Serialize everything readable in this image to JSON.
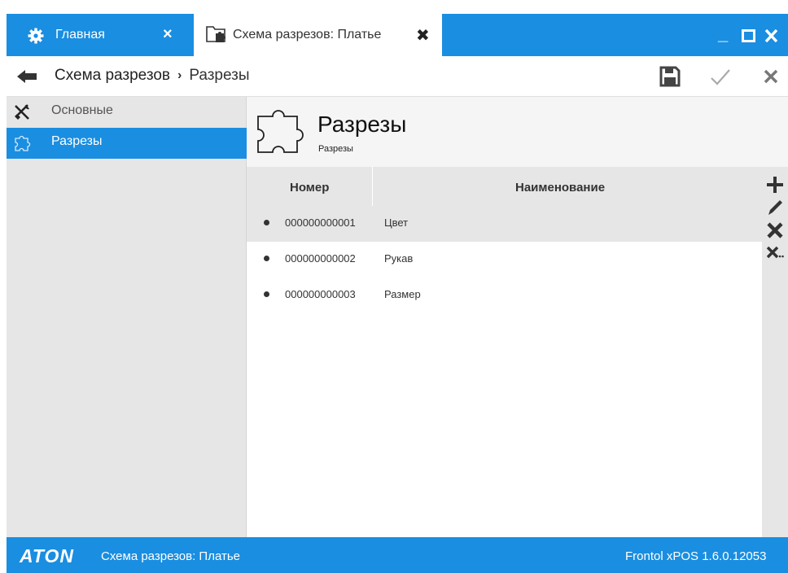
{
  "colors": {
    "accent": "#1a8ee1",
    "panel": "#e6e6e6",
    "header_bg": "#f5f5f5"
  },
  "tabs": [
    {
      "label": "Главная",
      "icon": "gear-icon",
      "close": "×"
    },
    {
      "label": "Схема разрезов: Платье",
      "icon": "folder-puzzle-icon",
      "close": "✖"
    }
  ],
  "window": {
    "minimize": "_",
    "maximize": "□",
    "close": "×"
  },
  "toolbar": {
    "breadcrumb": [
      "Схема разрезов",
      "Разрезы"
    ],
    "separator": "›",
    "actions": [
      "save-icon",
      "check-icon",
      "close-icon"
    ]
  },
  "sidebar": {
    "items": [
      {
        "label": "Основные",
        "icon": "tools-icon",
        "active": false
      },
      {
        "label": "Разрезы",
        "icon": "puzzle-icon",
        "active": true
      }
    ]
  },
  "page": {
    "title": "Разрезы",
    "subtitle": "Разрезы"
  },
  "grid": {
    "columns": [
      "Номер",
      "Наименование"
    ],
    "rows": [
      {
        "number": "000000000001",
        "name": "Цвет",
        "selected": true
      },
      {
        "number": "000000000002",
        "name": "Рукав",
        "selected": false
      },
      {
        "number": "000000000003",
        "name": "Размер",
        "selected": false
      }
    ]
  },
  "side_actions": [
    "plus-icon",
    "pencil-icon",
    "delete-icon",
    "delete-all-icon"
  ],
  "statusbar": {
    "logo": "ATON",
    "text": "Схема разрезов: Платье",
    "version": "Frontol xPOS 1.6.0.12053"
  }
}
